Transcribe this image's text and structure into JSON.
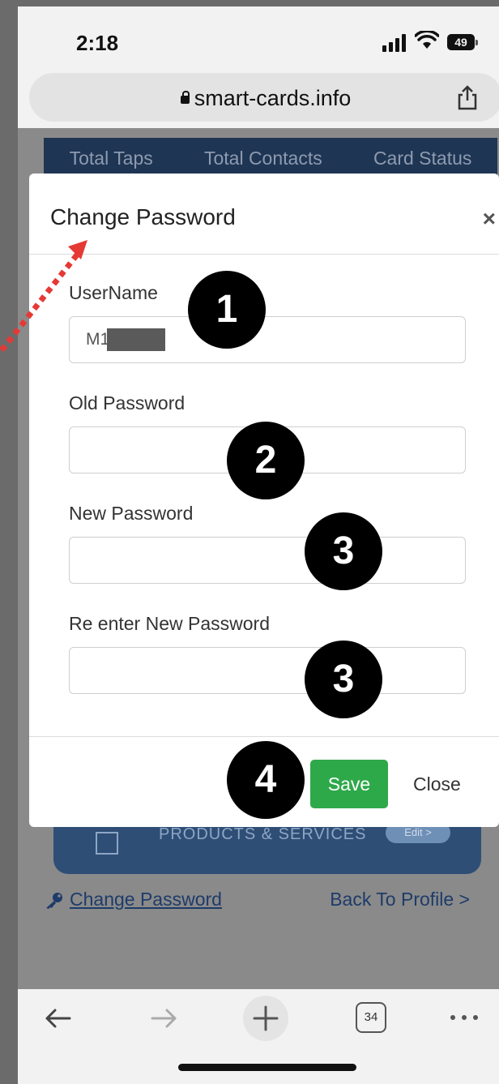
{
  "status": {
    "time": "2:18",
    "battery": "49"
  },
  "browser": {
    "url": "smart-cards.info",
    "tab_count": "34"
  },
  "background_page": {
    "stats_headers": [
      "Total Taps",
      "Total Contacts",
      "Card Status"
    ],
    "products_label": "PRODUCTS & SERVICES",
    "products_edit": "Edit >",
    "change_password_link": "Change Password",
    "back_to_profile_link": "Back To Profile >"
  },
  "modal": {
    "title": "Change Password",
    "close_icon": "×",
    "fields": [
      {
        "label": "UserName",
        "value": "M1"
      },
      {
        "label": "Old Password",
        "value": ""
      },
      {
        "label": "New Password",
        "value": ""
      },
      {
        "label": "Re enter New Password",
        "value": ""
      }
    ],
    "save_label": "Save",
    "close_label": "Close"
  },
  "annotations": {
    "steps": [
      "1",
      "2",
      "3",
      "3",
      "4"
    ],
    "arrow_color": "#e53935"
  },
  "colors": {
    "save_button": "#2ea94a",
    "modal_bg": "#ffffff",
    "header_navy": "#1f3554"
  }
}
